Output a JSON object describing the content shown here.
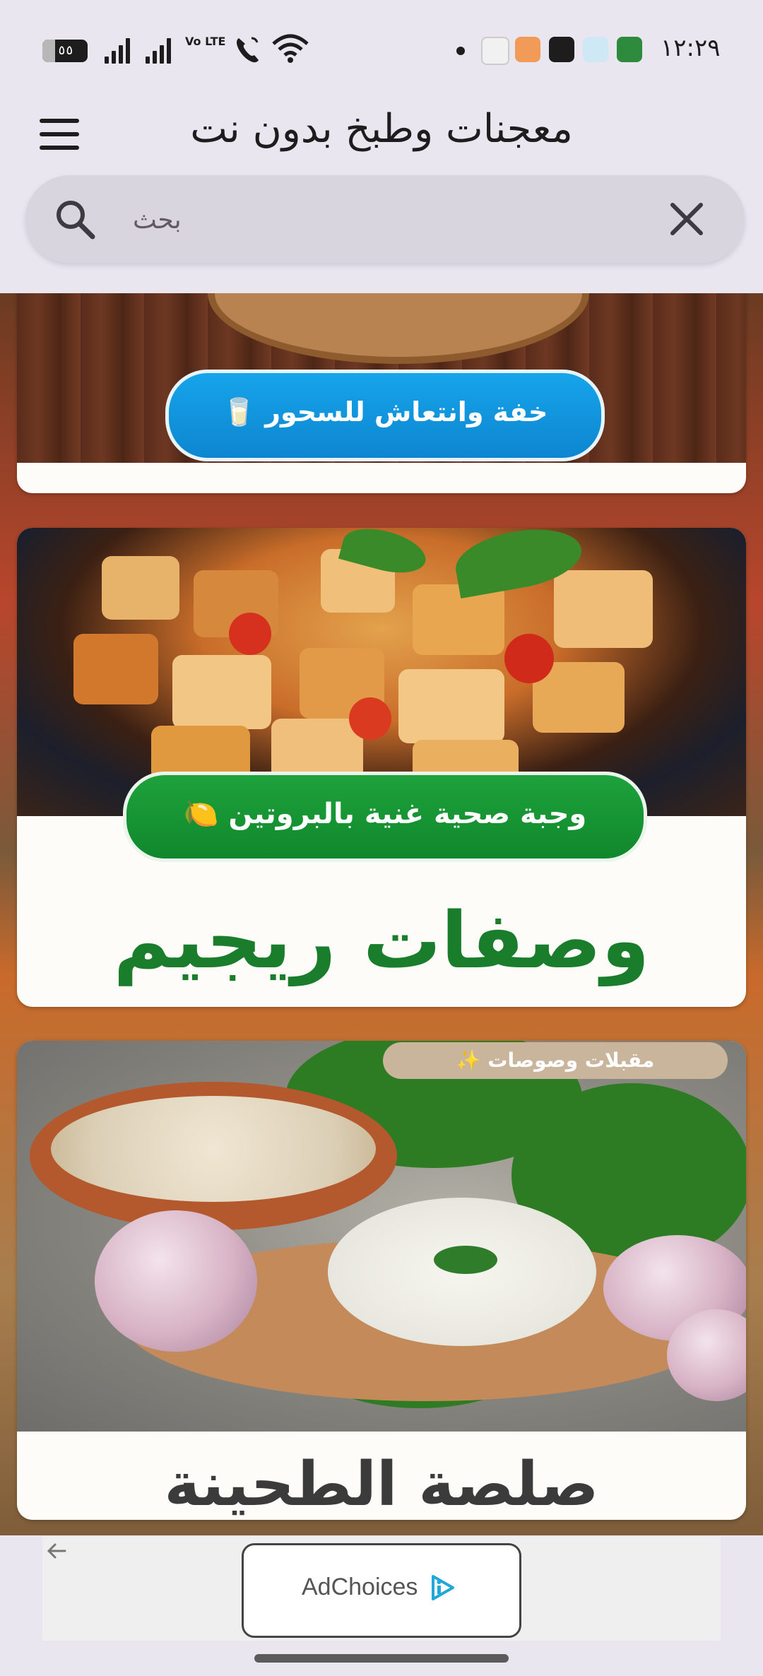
{
  "status_bar": {
    "battery_level": "٥٥",
    "network": "Vo LTE",
    "time": "١٢:٢٩"
  },
  "app_bar": {
    "title": "معجنات وطبخ بدون نت",
    "search_placeholder": "بحث"
  },
  "cards": [
    {
      "pill": "خفة وانتعاش للسحور 🥛",
      "pill_color": "#1199e0"
    },
    {
      "pill": "وجبة صحية غنية بالبروتين 🍋",
      "caption": "وصفات ريجيم",
      "pill_color": "#17952f",
      "caption_color": "#1a7d2c"
    },
    {
      "tag": "مقبلات وصوصات ✨",
      "caption": "صلصة الطحينة"
    }
  ],
  "ad": {
    "label": "AdChoices"
  },
  "colors": {
    "background": "#e9e6f0",
    "search_bar": "#d9d5de",
    "adchoices_blue": "#22a7d8"
  }
}
